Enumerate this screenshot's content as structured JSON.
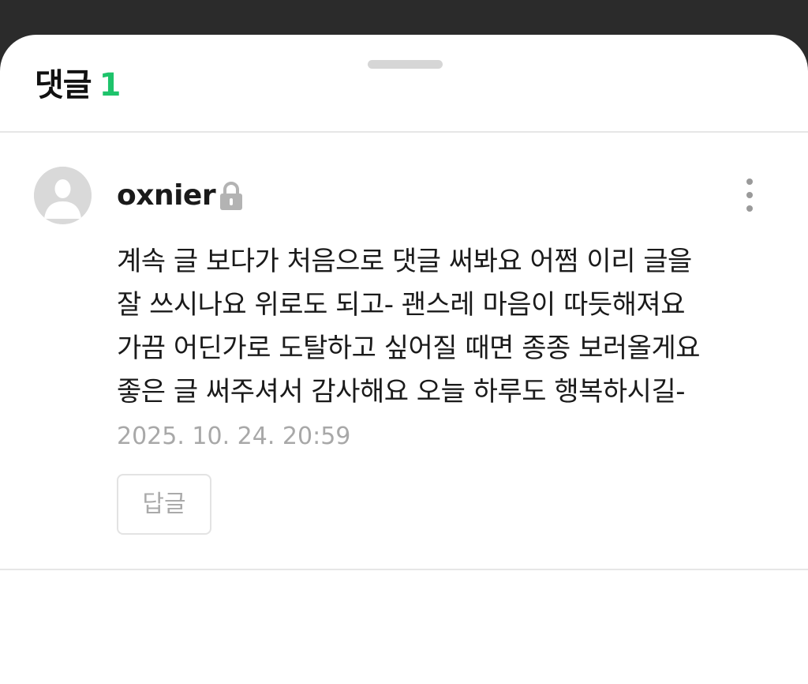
{
  "sheet": {
    "title": "댓글",
    "count": "1"
  },
  "comment": {
    "username": "oxnier",
    "lock_icon": "lock-icon",
    "more_icon": "more-vertical-icon",
    "avatar_icon": "default-avatar-icon",
    "lines": [
      "계속 글 보다가 처음으로 댓글 써봐요 어쩜 이리 글을",
      "잘 쓰시나요 위로도 되고- 괜스레 마음이 따듯해져요",
      "가끔 어딘가로 도탈하고 싶어질 때면 종종 보러올게요",
      "좋은 글 써주셔서 감사해요 오늘 하루도 행복하시길-"
    ],
    "timestamp": "2025. 10. 24. 20:59",
    "reply_label": "답글"
  },
  "colors": {
    "accent": "#1ec36b",
    "lock": "#b3b3b3",
    "timestamp": "#a8a8a8"
  }
}
